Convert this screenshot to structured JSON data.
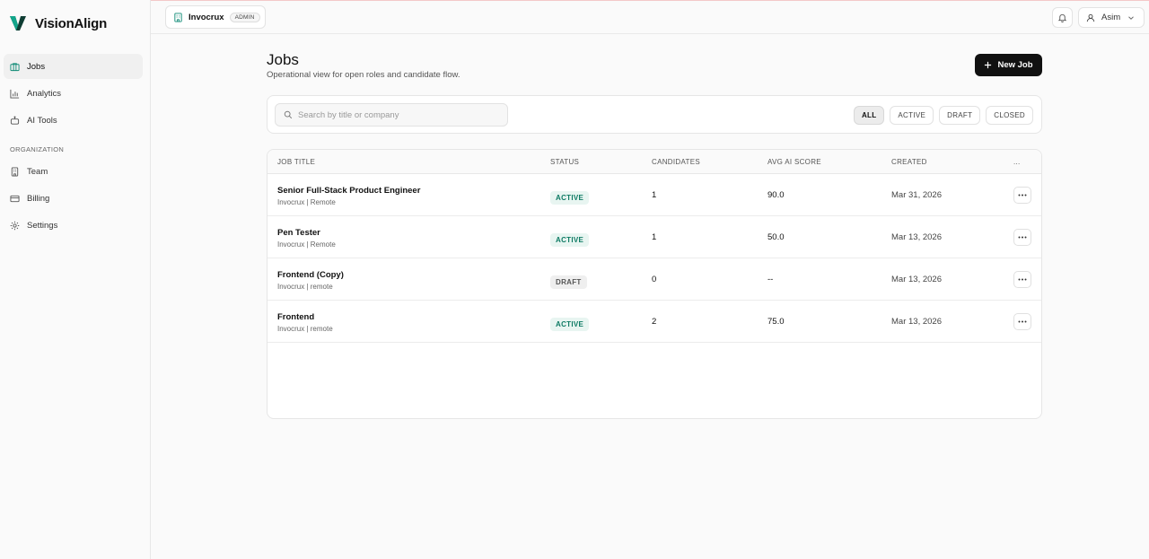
{
  "brand": {
    "name": "VisionAlign",
    "logo_icon": "v-logo-icon"
  },
  "sidebar": {
    "items": [
      {
        "label": "Jobs",
        "icon": "briefcase-icon",
        "active": true
      },
      {
        "label": "Analytics",
        "icon": "bar-chart-icon",
        "active": false
      },
      {
        "label": "AI Tools",
        "icon": "robot-icon",
        "active": false
      }
    ],
    "section_label": "ORGANIZATION",
    "org_items": [
      {
        "label": "Team",
        "icon": "building-icon"
      },
      {
        "label": "Billing",
        "icon": "credit-card-icon"
      },
      {
        "label": "Settings",
        "icon": "gear-icon"
      }
    ]
  },
  "header": {
    "workspace_name": "Invocrux",
    "workspace_role": "ADMIN",
    "user_name": "Asim"
  },
  "page": {
    "title": "Jobs",
    "subtitle": "Operational view for open roles and candidate flow.",
    "new_job_label": "New Job"
  },
  "search": {
    "placeholder": "Search by title or company"
  },
  "filters": [
    {
      "label": "ALL",
      "active": true
    },
    {
      "label": "ACTIVE",
      "active": false
    },
    {
      "label": "DRAFT",
      "active": false
    },
    {
      "label": "CLOSED",
      "active": false
    }
  ],
  "table": {
    "columns": {
      "title": "JOB TITLE",
      "status": "STATUS",
      "candidates": "CANDIDATES",
      "score": "AVG AI SCORE",
      "created": "CREATED",
      "actions": "..."
    },
    "rows": [
      {
        "title": "Senior Full-Stack Product Engineer",
        "meta": "Invocrux | Remote",
        "status": "ACTIVE",
        "candidates": "1",
        "score": "90.0",
        "created": "Mar 31, 2026"
      },
      {
        "title": "Pen Tester",
        "meta": "Invocrux | Remote",
        "status": "ACTIVE",
        "candidates": "1",
        "score": "50.0",
        "created": "Mar 13, 2026"
      },
      {
        "title": "Frontend (Copy)",
        "meta": "Invocrux | remote",
        "status": "DRAFT",
        "candidates": "0",
        "score": "--",
        "created": "Mar 13, 2026"
      },
      {
        "title": "Frontend",
        "meta": "Invocrux | remote",
        "status": "ACTIVE",
        "candidates": "2",
        "score": "75.0",
        "created": "Mar 13, 2026"
      }
    ]
  },
  "colors": {
    "accent": "#0e8a75",
    "primary_button": "#111111",
    "active_badge_bg": "#e8f5f1",
    "active_badge_text": "#0d7a63"
  }
}
